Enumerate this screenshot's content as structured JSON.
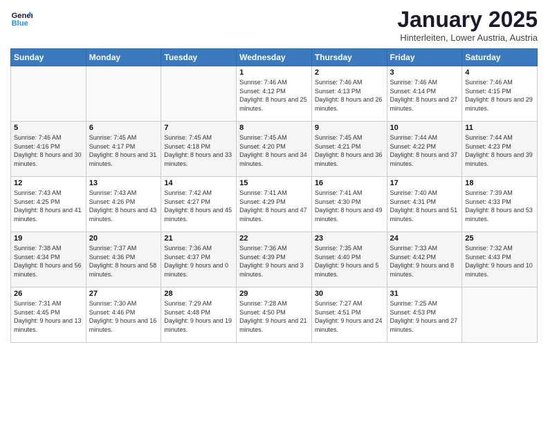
{
  "header": {
    "logo_line1": "General",
    "logo_line2": "Blue",
    "month_title": "January 2025",
    "location": "Hinterleiten, Lower Austria, Austria"
  },
  "weekdays": [
    "Sunday",
    "Monday",
    "Tuesday",
    "Wednesday",
    "Thursday",
    "Friday",
    "Saturday"
  ],
  "weeks": [
    [
      {
        "day": "",
        "sunrise": "",
        "sunset": "",
        "daylight": ""
      },
      {
        "day": "",
        "sunrise": "",
        "sunset": "",
        "daylight": ""
      },
      {
        "day": "",
        "sunrise": "",
        "sunset": "",
        "daylight": ""
      },
      {
        "day": "1",
        "sunrise": "Sunrise: 7:46 AM",
        "sunset": "Sunset: 4:12 PM",
        "daylight": "Daylight: 8 hours and 25 minutes."
      },
      {
        "day": "2",
        "sunrise": "Sunrise: 7:46 AM",
        "sunset": "Sunset: 4:13 PM",
        "daylight": "Daylight: 8 hours and 26 minutes."
      },
      {
        "day": "3",
        "sunrise": "Sunrise: 7:46 AM",
        "sunset": "Sunset: 4:14 PM",
        "daylight": "Daylight: 8 hours and 27 minutes."
      },
      {
        "day": "4",
        "sunrise": "Sunrise: 7:46 AM",
        "sunset": "Sunset: 4:15 PM",
        "daylight": "Daylight: 8 hours and 29 minutes."
      }
    ],
    [
      {
        "day": "5",
        "sunrise": "Sunrise: 7:46 AM",
        "sunset": "Sunset: 4:16 PM",
        "daylight": "Daylight: 8 hours and 30 minutes."
      },
      {
        "day": "6",
        "sunrise": "Sunrise: 7:45 AM",
        "sunset": "Sunset: 4:17 PM",
        "daylight": "Daylight: 8 hours and 31 minutes."
      },
      {
        "day": "7",
        "sunrise": "Sunrise: 7:45 AM",
        "sunset": "Sunset: 4:18 PM",
        "daylight": "Daylight: 8 hours and 33 minutes."
      },
      {
        "day": "8",
        "sunrise": "Sunrise: 7:45 AM",
        "sunset": "Sunset: 4:20 PM",
        "daylight": "Daylight: 8 hours and 34 minutes."
      },
      {
        "day": "9",
        "sunrise": "Sunrise: 7:45 AM",
        "sunset": "Sunset: 4:21 PM",
        "daylight": "Daylight: 8 hours and 36 minutes."
      },
      {
        "day": "10",
        "sunrise": "Sunrise: 7:44 AM",
        "sunset": "Sunset: 4:22 PM",
        "daylight": "Daylight: 8 hours and 37 minutes."
      },
      {
        "day": "11",
        "sunrise": "Sunrise: 7:44 AM",
        "sunset": "Sunset: 4:23 PM",
        "daylight": "Daylight: 8 hours and 39 minutes."
      }
    ],
    [
      {
        "day": "12",
        "sunrise": "Sunrise: 7:43 AM",
        "sunset": "Sunset: 4:25 PM",
        "daylight": "Daylight: 8 hours and 41 minutes."
      },
      {
        "day": "13",
        "sunrise": "Sunrise: 7:43 AM",
        "sunset": "Sunset: 4:26 PM",
        "daylight": "Daylight: 8 hours and 43 minutes."
      },
      {
        "day": "14",
        "sunrise": "Sunrise: 7:42 AM",
        "sunset": "Sunset: 4:27 PM",
        "daylight": "Daylight: 8 hours and 45 minutes."
      },
      {
        "day": "15",
        "sunrise": "Sunrise: 7:41 AM",
        "sunset": "Sunset: 4:29 PM",
        "daylight": "Daylight: 8 hours and 47 minutes."
      },
      {
        "day": "16",
        "sunrise": "Sunrise: 7:41 AM",
        "sunset": "Sunset: 4:30 PM",
        "daylight": "Daylight: 8 hours and 49 minutes."
      },
      {
        "day": "17",
        "sunrise": "Sunrise: 7:40 AM",
        "sunset": "Sunset: 4:31 PM",
        "daylight": "Daylight: 8 hours and 51 minutes."
      },
      {
        "day": "18",
        "sunrise": "Sunrise: 7:39 AM",
        "sunset": "Sunset: 4:33 PM",
        "daylight": "Daylight: 8 hours and 53 minutes."
      }
    ],
    [
      {
        "day": "19",
        "sunrise": "Sunrise: 7:38 AM",
        "sunset": "Sunset: 4:34 PM",
        "daylight": "Daylight: 8 hours and 56 minutes."
      },
      {
        "day": "20",
        "sunrise": "Sunrise: 7:37 AM",
        "sunset": "Sunset: 4:36 PM",
        "daylight": "Daylight: 8 hours and 58 minutes."
      },
      {
        "day": "21",
        "sunrise": "Sunrise: 7:36 AM",
        "sunset": "Sunset: 4:37 PM",
        "daylight": "Daylight: 9 hours and 0 minutes."
      },
      {
        "day": "22",
        "sunrise": "Sunrise: 7:36 AM",
        "sunset": "Sunset: 4:39 PM",
        "daylight": "Daylight: 9 hours and 3 minutes."
      },
      {
        "day": "23",
        "sunrise": "Sunrise: 7:35 AM",
        "sunset": "Sunset: 4:40 PM",
        "daylight": "Daylight: 9 hours and 5 minutes."
      },
      {
        "day": "24",
        "sunrise": "Sunrise: 7:33 AM",
        "sunset": "Sunset: 4:42 PM",
        "daylight": "Daylight: 9 hours and 8 minutes."
      },
      {
        "day": "25",
        "sunrise": "Sunrise: 7:32 AM",
        "sunset": "Sunset: 4:43 PM",
        "daylight": "Daylight: 9 hours and 10 minutes."
      }
    ],
    [
      {
        "day": "26",
        "sunrise": "Sunrise: 7:31 AM",
        "sunset": "Sunset: 4:45 PM",
        "daylight": "Daylight: 9 hours and 13 minutes."
      },
      {
        "day": "27",
        "sunrise": "Sunrise: 7:30 AM",
        "sunset": "Sunset: 4:46 PM",
        "daylight": "Daylight: 9 hours and 16 minutes."
      },
      {
        "day": "28",
        "sunrise": "Sunrise: 7:29 AM",
        "sunset": "Sunset: 4:48 PM",
        "daylight": "Daylight: 9 hours and 19 minutes."
      },
      {
        "day": "29",
        "sunrise": "Sunrise: 7:28 AM",
        "sunset": "Sunset: 4:50 PM",
        "daylight": "Daylight: 9 hours and 21 minutes."
      },
      {
        "day": "30",
        "sunrise": "Sunrise: 7:27 AM",
        "sunset": "Sunset: 4:51 PM",
        "daylight": "Daylight: 9 hours and 24 minutes."
      },
      {
        "day": "31",
        "sunrise": "Sunrise: 7:25 AM",
        "sunset": "Sunset: 4:53 PM",
        "daylight": "Daylight: 9 hours and 27 minutes."
      },
      {
        "day": "",
        "sunrise": "",
        "sunset": "",
        "daylight": ""
      }
    ]
  ]
}
